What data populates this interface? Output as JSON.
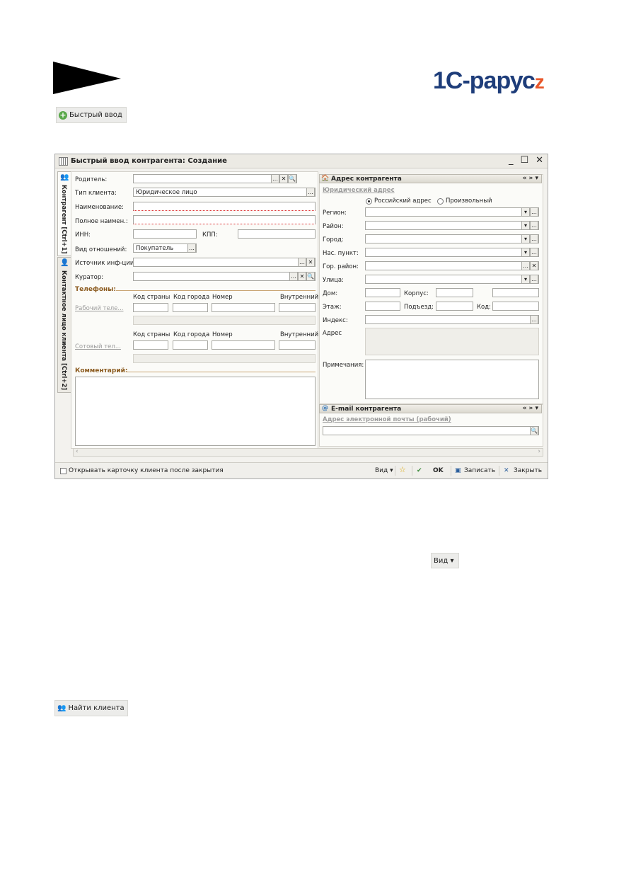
{
  "logo": {
    "main": "1С-рарус",
    "swoosh": "z"
  },
  "quick_entry_button": {
    "label": "Быстрый ввод",
    "icon": "green-plus-icon"
  },
  "window": {
    "title": "Быстрый ввод контрагента: Создание",
    "controls": {
      "minimize": "_",
      "maximize": "☐",
      "close": "✕"
    },
    "tabs": [
      {
        "label": "Контрагент [Ctrl+1]"
      },
      {
        "label": "Контактное лицо клиента [Ctrl+2]"
      }
    ],
    "form": {
      "parent_label": "Родитель:",
      "client_type_label": "Тип клиента:",
      "client_type_value": "Юридическое лицо",
      "name_label": "Наименование:",
      "full_name_label": "Полное наимен.:",
      "inn_label": "ИНН:",
      "kpp_label": "КПП:",
      "relation_label": "Вид отношений:",
      "relation_value": "Покупатель",
      "source_label": "Источник инф-ции:",
      "curator_label": "Куратор:",
      "phones_label": "Телефоны:",
      "phone_cols": [
        "Код страны",
        "Код города",
        "Номер",
        "Внутренний"
      ],
      "work_phone_label": "Рабочий теле...",
      "mobile_phone_label": "Сотовый тел...",
      "comment_label": "Комментарий:"
    },
    "address_panel": {
      "title": "Адрес контрагента",
      "nav": "« » ▾",
      "legal_address": "Юридический адрес",
      "radio_russian": "Российский адрес",
      "radio_custom": "Произвольный",
      "region": "Регион:",
      "district": "Район:",
      "city": "Город:",
      "settlement": "Нас. пункт:",
      "city_district": "Гор. район:",
      "street": "Улица:",
      "house": "Дом:",
      "building": "Корпус:",
      "floor": "Этаж:",
      "entrance": "Подъезд:",
      "code": "Код:",
      "index": "Индекс:",
      "address": "Адрес",
      "notes": "Примечания:"
    },
    "email_panel": {
      "title": "E-mail контрагента",
      "nav": "« » ▾",
      "field_label": "Адрес электронной почты (рабочий)"
    },
    "statusbar": {
      "open_card": "Открывать карточку клиента после закрытия",
      "view": "Вид ▾",
      "ok": "OK",
      "save": "Записать",
      "close": "Закрыть"
    }
  },
  "view_button": {
    "label": "Вид ▾"
  },
  "find_client_button": {
    "label": "Найти клиента"
  }
}
